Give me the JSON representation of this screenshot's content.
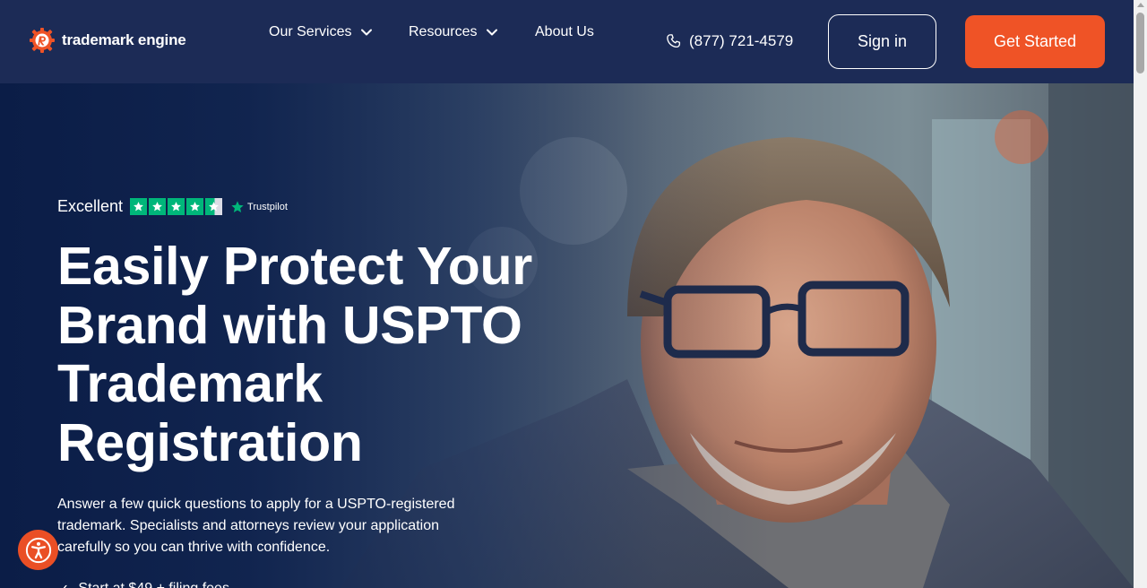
{
  "header": {
    "logo_text": "trademark engine",
    "nav": {
      "services_label": "Our Services",
      "resources_label": "Resources",
      "about_label": "About Us"
    },
    "phone": "(877) 721-4579",
    "signin_label": "Sign in",
    "get_started_label": "Get Started"
  },
  "hero": {
    "rating_word": "Excellent",
    "rating_stars": 4.5,
    "rating_provider": "Trustpilot",
    "headline": "Easily Protect Your Brand with USPTO Trademark Registration",
    "subtext": "Answer a few quick questions to apply for a USPTO-registered trademark. Specialists and attorneys review your application carefully so you can thrive with confidence.",
    "bullet": "Start at $49 + filing fees"
  },
  "icons": {
    "logo": "trademark-engine-logo-icon",
    "phone": "phone-icon",
    "chevron": "chevron-down-icon",
    "star": "star-icon",
    "accessibility": "accessibility-icon"
  },
  "colors": {
    "header_bg": "#1c2b56",
    "accent": "#ef5326",
    "trustpilot_green": "#00b67a",
    "text": "#ffffff"
  }
}
